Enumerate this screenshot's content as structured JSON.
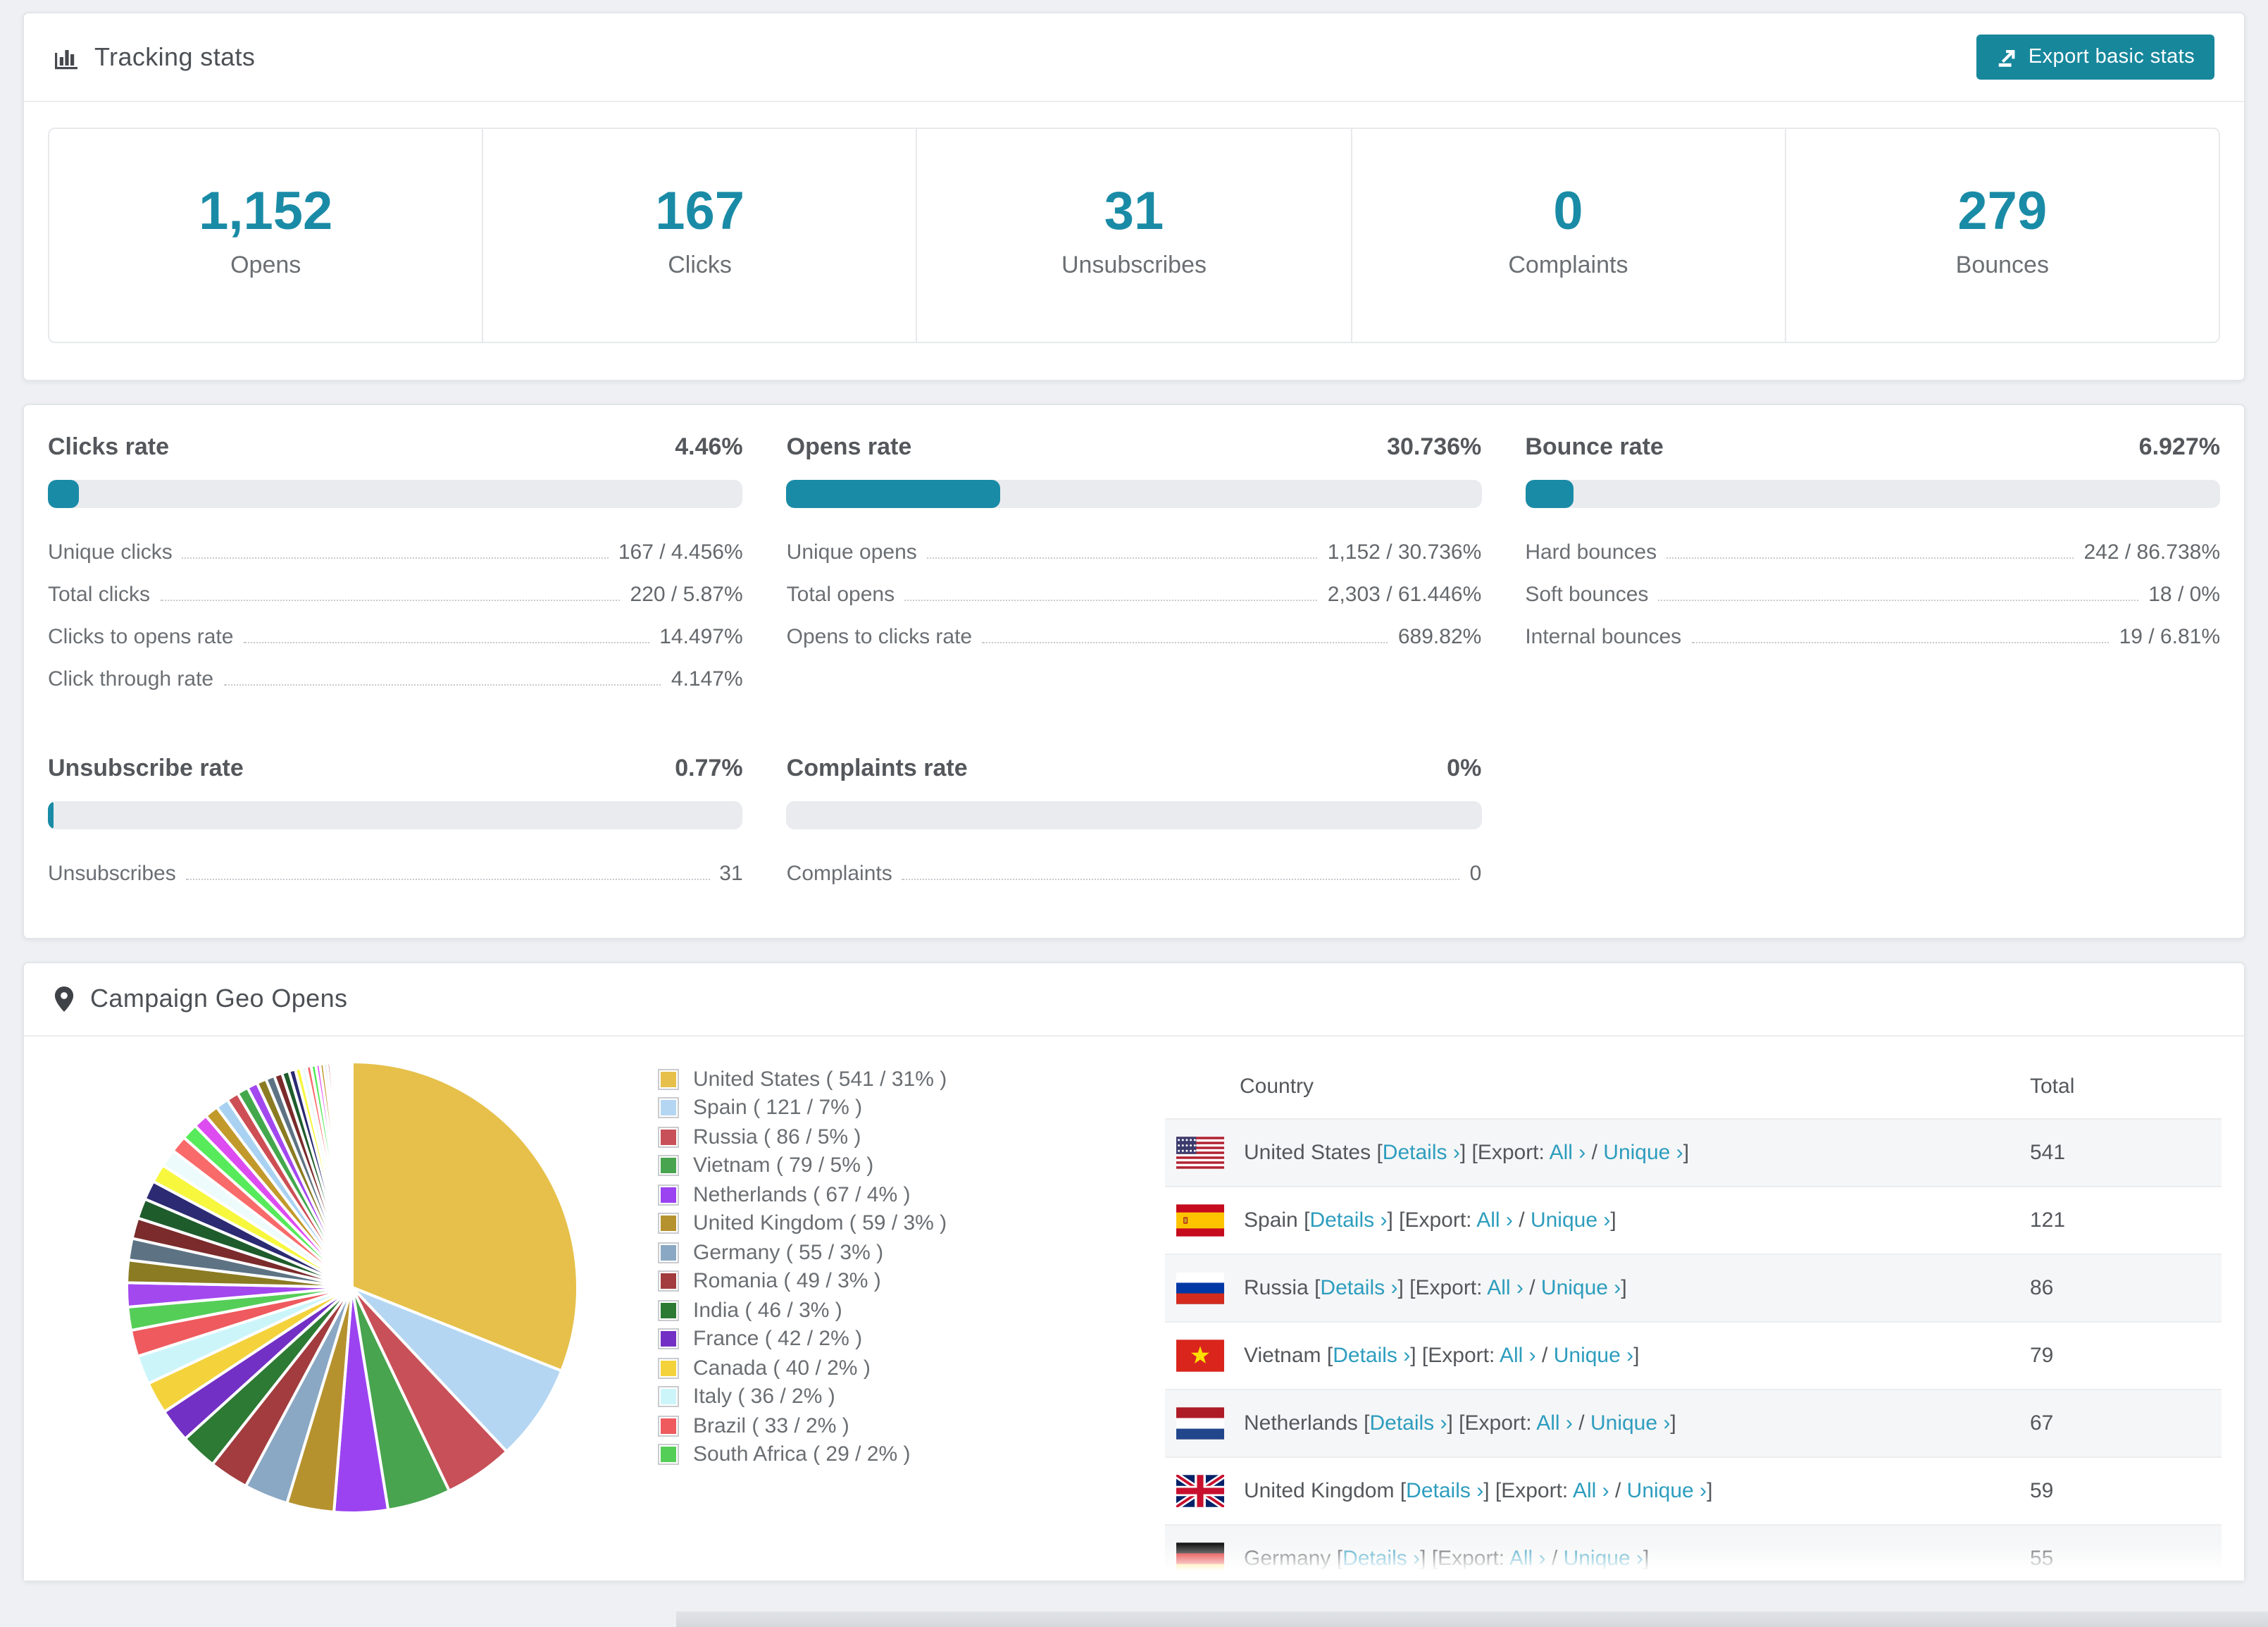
{
  "accent": "#1a8ba6",
  "link_color": "#2d9dbe",
  "tracking": {
    "title": "Tracking stats",
    "export_button": "Export basic stats",
    "stats": [
      {
        "value": "1,152",
        "label": "Opens"
      },
      {
        "value": "167",
        "label": "Clicks"
      },
      {
        "value": "31",
        "label": "Unsubscribes"
      },
      {
        "value": "0",
        "label": "Complaints"
      },
      {
        "value": "279",
        "label": "Bounces"
      }
    ]
  },
  "rates": {
    "blocks": [
      {
        "title": "Clicks rate",
        "percent": "4.46%",
        "bar_pct": 4.46,
        "rows": [
          {
            "label": "Unique clicks",
            "value": "167 / 4.456%"
          },
          {
            "label": "Total clicks",
            "value": "220 / 5.87%"
          },
          {
            "label": "Clicks to opens rate",
            "value": "14.497%"
          },
          {
            "label": "Click through rate",
            "value": "4.147%"
          }
        ]
      },
      {
        "title": "Opens rate",
        "percent": "30.736%",
        "bar_pct": 30.736,
        "rows": [
          {
            "label": "Unique opens",
            "value": "1,152 / 30.736%"
          },
          {
            "label": "Total opens",
            "value": "2,303 / 61.446%"
          },
          {
            "label": "Opens to clicks rate",
            "value": "689.82%"
          }
        ]
      },
      {
        "title": "Bounce rate",
        "percent": "6.927%",
        "bar_pct": 6.927,
        "rows": [
          {
            "label": "Hard bounces",
            "value": "242 / 86.738%"
          },
          {
            "label": "Soft bounces",
            "value": "18 / 0%"
          },
          {
            "label": "Internal bounces",
            "value": "19 / 6.81%"
          }
        ]
      },
      {
        "title": "Unsubscribe rate",
        "percent": "0.77%",
        "bar_pct": 0.77,
        "rows": [
          {
            "label": "Unsubscribes",
            "value": "31"
          }
        ]
      },
      {
        "title": "Complaints rate",
        "percent": "0%",
        "bar_pct": 0,
        "rows": [
          {
            "label": "Complaints",
            "value": "0"
          }
        ]
      }
    ]
  },
  "geo": {
    "title": "Campaign Geo Opens",
    "chart_data": {
      "type": "pie",
      "title": "Campaign Geo Opens",
      "legend_position": "right",
      "start_angle_deg": -90,
      "direction": "clockwise",
      "labels": [
        "United States",
        "Spain",
        "Russia",
        "Vietnam",
        "Netherlands",
        "United Kingdom",
        "Germany",
        "Romania",
        "India",
        "France",
        "Canada",
        "Italy",
        "Brazil",
        "South Africa"
      ],
      "values": [
        541,
        121,
        86,
        79,
        67,
        59,
        55,
        49,
        46,
        42,
        40,
        36,
        33,
        29
      ],
      "percents": [
        31,
        7,
        5,
        5,
        4,
        3,
        3,
        3,
        3,
        2,
        2,
        2,
        2,
        2
      ],
      "colors": [
        "#e6c04a",
        "#b4d6f2",
        "#c85058",
        "#48a44e",
        "#9b43f0",
        "#b6922f",
        "#8aa8c4",
        "#a23c3e",
        "#2d7a34",
        "#7330c4",
        "#f3d23c",
        "#ccf5fa",
        "#ee5a5e",
        "#55ce58"
      ],
      "unlabeled_tail": {
        "description": "many small unlabeled country slices shrinking to hairlines",
        "values": [
          30,
          28,
          27,
          26,
          25,
          24,
          23,
          22,
          21,
          20,
          18,
          17,
          16,
          15,
          14,
          13,
          12,
          11,
          10,
          9,
          8,
          7,
          7,
          6,
          6,
          5,
          5,
          4,
          4,
          3,
          3,
          3,
          2,
          2,
          2,
          2,
          1,
          1,
          1,
          1,
          1,
          1,
          1,
          1,
          1,
          1
        ],
        "colors_cycle": [
          "#a348ef",
          "#8b7b22",
          "#5d7384",
          "#7b2b2b",
          "#1e5c2c",
          "#2b2a72",
          "#f7f73e",
          "#eefbfd",
          "#f96a6a",
          "#57ea5a",
          "#dd4cf0",
          "#c2992b",
          "#a9d2f2",
          "#cd4f55",
          "#43a84c"
        ]
      }
    },
    "legend_format": {
      "open": " ( ",
      "sep": " / ",
      "close": "% )"
    },
    "table": {
      "headers": {
        "country": "Country",
        "total": "Total"
      },
      "links": {
        "pre_details": "[",
        "details": "Details ›",
        "post_details": "] [Export: ",
        "all": "All ›",
        "slash": " / ",
        "unique": "Unique ›",
        "close": "]"
      },
      "rows": [
        {
          "flag": "us",
          "country": "United States",
          "total": "541"
        },
        {
          "flag": "es",
          "country": "Spain",
          "total": "121"
        },
        {
          "flag": "ru",
          "country": "Russia",
          "total": "86"
        },
        {
          "flag": "vn",
          "country": "Vietnam",
          "total": "79"
        },
        {
          "flag": "nl",
          "country": "Netherlands",
          "total": "67"
        },
        {
          "flag": "gb",
          "country": "United Kingdom",
          "total": "59"
        },
        {
          "flag": "de",
          "country": "Germany",
          "total": "55"
        }
      ]
    }
  }
}
